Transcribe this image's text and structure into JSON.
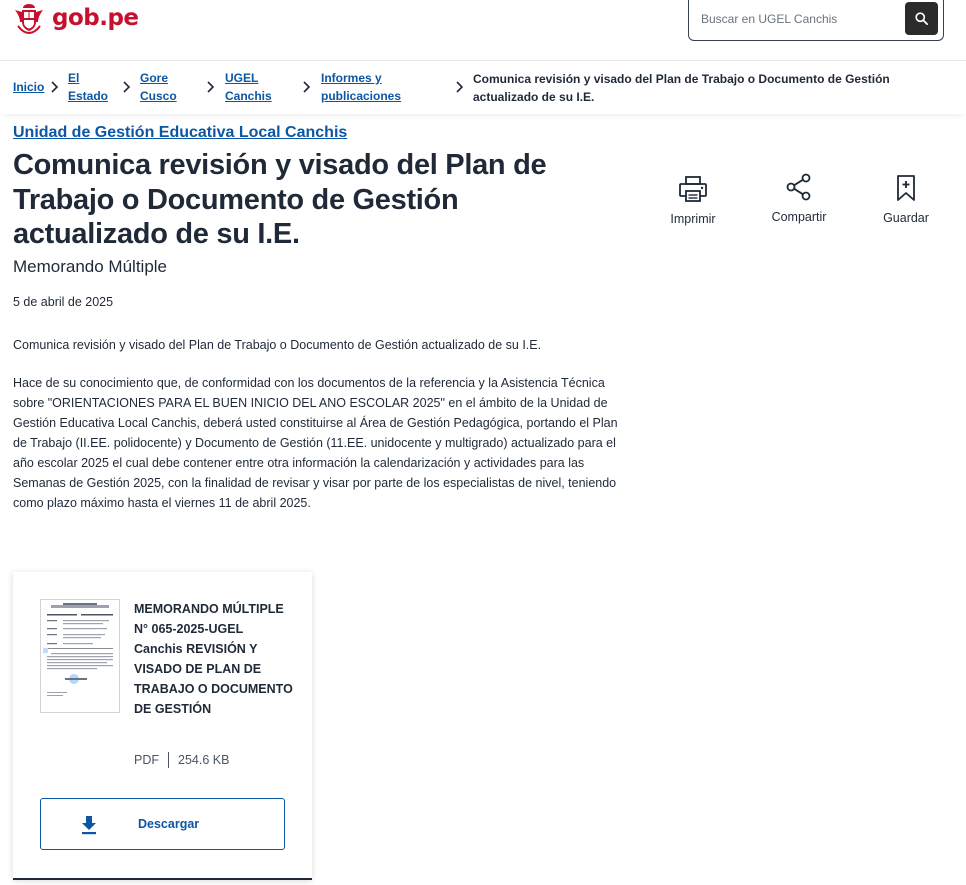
{
  "header": {
    "logo_text": "gob.pe",
    "search_placeholder": "Buscar en UGEL Canchis"
  },
  "breadcrumb": {
    "items": [
      {
        "label": "Inicio"
      },
      {
        "label_line1": "El",
        "label_line2": "Estado"
      },
      {
        "label_line1": "Gore",
        "label_line2": "Cusco"
      },
      {
        "label_line1": "UGEL",
        "label_line2": "Canchis"
      },
      {
        "label_line1": "Informes y",
        "label_line2": "publicaciones"
      }
    ],
    "current": "Comunica revisión y visado del Plan de Trabajo o Documento de Gestión actualizado de su I.E."
  },
  "article": {
    "org": "Unidad de Gestión Educativa Local Canchis",
    "title": "Comunica revisión y visado del Plan de Trabajo o Documento de Gestión actualizado de su I.E.",
    "subtitle": "Memorando Múltiple",
    "date": "5 de abril de 2025",
    "paragraph1": "Comunica revisión y visado del Plan de Trabajo o Documento de Gestión actualizado de su I.E.",
    "paragraph2": "Hace de su conocimiento que, de conformidad con los documentos de la referencia y la Asistencia Técnica sobre \"ORIENTACIONES PARA EL BUEN INICIO DEL ANO ESCOLAR 2025\" en el ámbito de la Unidad de Gestión Educativa Local Canchis, deberá usted constituirse al Área de Gestión Pedagógica, portando el Plan de Trabajo (II.EE. polidocente) y Documento de Gestión (11.EE. unidocente y multigrado) actualizado para el año escolar 2025 el cual debe contener entre otra información la calendarización y actividades para las Semanas de Gestión 2025, con la finalidad de revisar y visar por parte de los especialistas de nivel, teniendo como plazo máximo hasta el viernes 11 de abril 2025."
  },
  "actions": {
    "print": "Imprimir",
    "share": "Compartir",
    "save": "Guardar"
  },
  "document": {
    "title": "MEMORANDO MÚLTIPLE N° 065-2025-UGEL Canchis REVISIÓN Y VISADO DE PLAN DE TRABAJO O DOCUMENTO DE GESTIÓN",
    "format": "PDF",
    "size": "254.6 KB",
    "download_label": "Descargar"
  },
  "icons": {
    "logo": "peru-coat-of-arms-icon",
    "search": "search-icon",
    "chevron": "chevron-right-icon",
    "print": "printer-icon",
    "share": "share-icon",
    "save": "bookmark-icon",
    "download": "download-icon"
  },
  "colors": {
    "brand_red": "#c8102e",
    "link_blue": "#0b57a4",
    "text": "#1f2937"
  }
}
